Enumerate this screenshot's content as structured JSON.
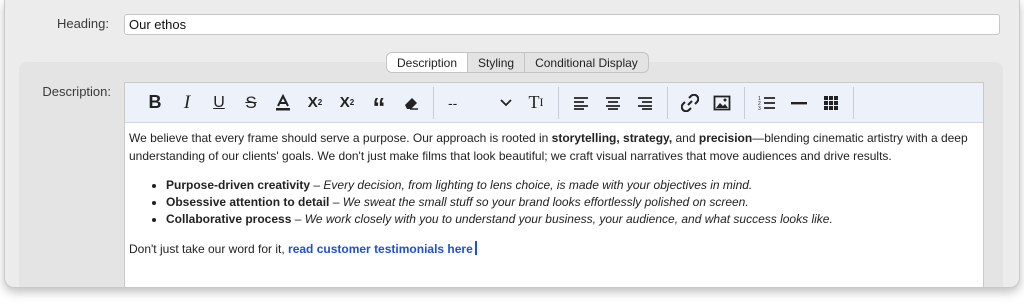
{
  "heading": {
    "label": "Heading:",
    "value": "Our ethos"
  },
  "tabs": [
    {
      "label": "Description",
      "active": true
    },
    {
      "label": "Styling",
      "active": false
    },
    {
      "label": "Conditional Display",
      "active": false
    }
  ],
  "description": {
    "label": "Description:",
    "toolbar": {
      "format_select": "--",
      "buttons": [
        "bold-icon",
        "italic-icon",
        "underline-icon",
        "strikethrough-icon",
        "text-color-icon",
        "superscript-icon",
        "subscript-icon",
        "blockquote-icon",
        "clear-format-icon",
        "text-size-icon",
        "align-left-icon",
        "align-center-icon",
        "align-right-icon",
        "link-icon",
        "image-icon",
        "ordered-list-icon",
        "horizontal-rule-icon",
        "table-icon"
      ]
    },
    "content": {
      "p1_a": "We believe that every frame should serve a purpose. Our approach is rooted in ",
      "p1_b": "storytelling, strategy,",
      "p1_c": " and ",
      "p1_d": "precision",
      "p1_e": "—blending cinematic artistry with a deep understanding of our clients' goals. We don't just make films that look beautiful; we craft visual narratives that move audiences and drive results.",
      "bullets": [
        {
          "title": "Purpose-driven creativity",
          "dash": " – ",
          "text": "Every decision, from lighting to lens choice, is made with your objectives in mind."
        },
        {
          "title": "Obsessive attention to detail",
          "dash": " – ",
          "text": "We sweat the small stuff so your brand looks effortlessly polished on screen."
        },
        {
          "title": "Collaborative process",
          "dash": " – ",
          "text": "We work closely with you to understand your business, your audience, and what success looks like."
        }
      ],
      "p2_a": "Don't just take our word for it, ",
      "p2_link": "read customer testimonials here"
    }
  },
  "colors": {
    "link": "#1f4fd6",
    "toolbar_bg": "#edf2fa"
  }
}
